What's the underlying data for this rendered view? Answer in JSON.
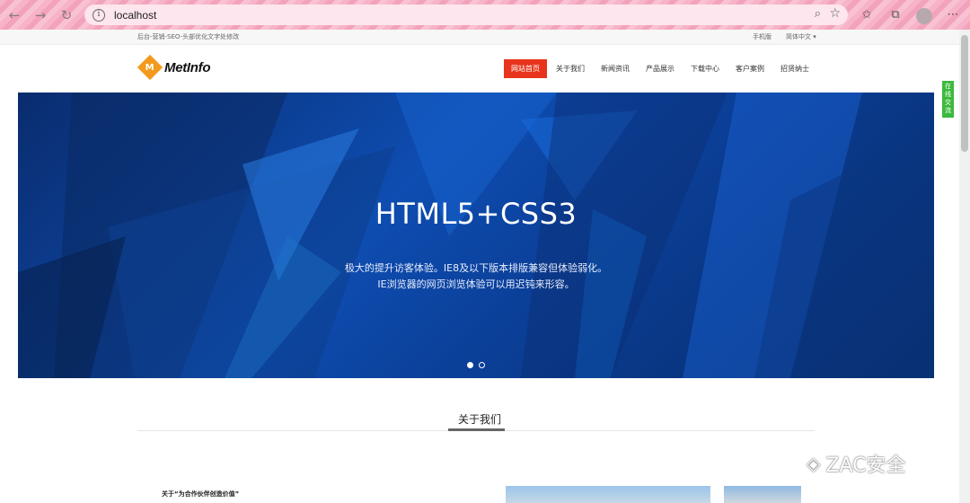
{
  "browser": {
    "url": "localhost",
    "back_icon": "arrow-left-icon",
    "forward_icon": "arrow-right-icon",
    "reload_icon": "reload-icon"
  },
  "topbar": {
    "tagline": "后台-营销-SEO-头部优化文字处修改",
    "mobile": "手机版",
    "lang": "简体中文 ▾"
  },
  "header": {
    "logo_mark": "M",
    "logo_text": "MetInfo"
  },
  "nav": {
    "items": [
      {
        "label": "网站首页"
      },
      {
        "label": "关于我们"
      },
      {
        "label": "新闻资讯"
      },
      {
        "label": "产品展示"
      },
      {
        "label": "下载中心"
      },
      {
        "label": "客户案例"
      },
      {
        "label": "招贤纳士"
      }
    ],
    "active_color": "#e8341c"
  },
  "banner": {
    "title": "HTML5+CSS3",
    "line1": "极大的提升访客体验。IE8及以下版本排版兼容但体验弱化。",
    "line2": "IE浏览器的网页浏览体验可以用迟钝来形容。",
    "slides": 2,
    "active_slide": 1
  },
  "side_tab": {
    "label": "在线交流",
    "color": "#3cb93c"
  },
  "about": {
    "section_title": "关于我们",
    "intro": "关于“为合作伙伴创造价值”"
  },
  "watermark": {
    "text": "ZAC安全",
    "icon": "wechat-icon"
  }
}
